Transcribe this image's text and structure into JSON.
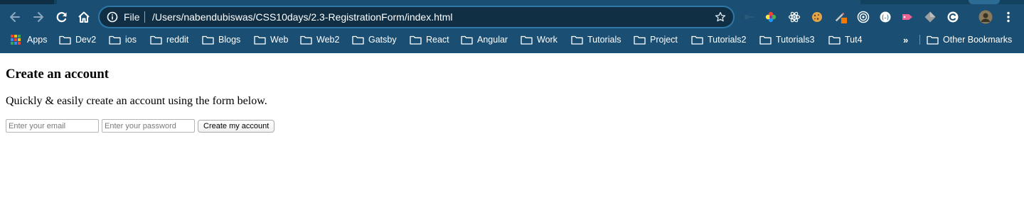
{
  "browser": {
    "address_bar": {
      "scheme_label": "File",
      "url": "/Users/nabendubiswas/CSS10days/2.3-RegistrationForm/index.html"
    },
    "icons": {
      "back": "arrow-left-icon",
      "forward": "arrow-right-icon",
      "reload": "reload-icon",
      "home": "home-icon",
      "info": "info-icon",
      "bookmark_star": "star-icon",
      "menu": "vertical-dots-icon"
    },
    "extensions": [
      "key-icon",
      "color-wheel-icon",
      "react-devtools-icon",
      "cookie-icon",
      "pencil-icon",
      "target-icon",
      "circle-h-icon",
      "tag-icon",
      "cube-icon",
      "refresh-c-icon",
      "profile-avatar-icon"
    ],
    "bookmarks": {
      "apps_label": "Apps",
      "folders": [
        "Dev2",
        "ios",
        "reddit",
        "Blogs",
        "Web",
        "Web2",
        "Gatsby",
        "React",
        "Angular",
        "Work",
        "Tutorials",
        "Project",
        "Tutorials2",
        "Tutorials3",
        "Tut4"
      ],
      "more_label": "»",
      "other_label": "Other Bookmarks"
    },
    "colors": {
      "chrome_background": "#1a4f73",
      "omnibox_background": "#102f44",
      "omnibox_focus_ring": "#2e77a8"
    }
  },
  "page": {
    "heading": "Create an account",
    "subtitle": "Quickly & easily create an account using the form below.",
    "form": {
      "email_placeholder": "Enter your email",
      "password_placeholder": "Enter your password",
      "submit_label": "Create my account"
    }
  }
}
